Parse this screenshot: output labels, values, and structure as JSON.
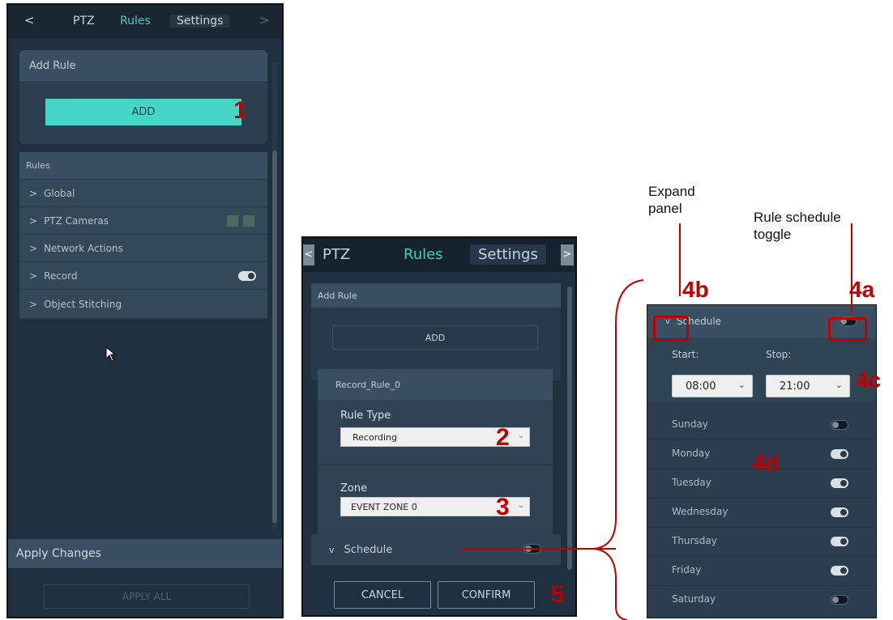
{
  "left_panel": {
    "tabs": {
      "prev": "<",
      "ptz": "PTZ",
      "rules": "Rules",
      "settings": "Settings",
      "next": ">"
    },
    "add_rule_header": "Add Rule",
    "add_button": "ADD",
    "rules_header": "Rules",
    "rule_groups": [
      {
        "label": "Global",
        "chevron": ">"
      },
      {
        "label": "PTZ Cameras",
        "chevron": ">"
      },
      {
        "label": "Network Actions",
        "chevron": ">"
      },
      {
        "label": "Record",
        "chevron": ">"
      },
      {
        "label": "Object Stitching",
        "chevron": ">"
      }
    ],
    "apply_changes_header": "Apply Changes",
    "apply_all_button": "APPLY ALL"
  },
  "middle_panel": {
    "tabs": {
      "prev": "<",
      "ptz": "PTZ",
      "rules": "Rules",
      "settings": "Settings",
      "next": ">"
    },
    "add_rule_header": "Add Rule",
    "add_button": "ADD",
    "rule_name": "Record_Rule_0",
    "rule_type_label": "Rule Type",
    "rule_type_value": "Recording",
    "zone_label": "Zone",
    "zone_value": "EVENT ZONE 0",
    "schedule_label": "Schedule",
    "schedule_chevron": "v",
    "cancel_button": "CANCEL",
    "confirm_button": "CONFIRM"
  },
  "right_panel": {
    "schedule_label": "Schedule",
    "schedule_chevron": "v",
    "start_label": "Start:",
    "start_value": "08:00",
    "stop_label": "Stop:",
    "stop_value": "21:00",
    "days": [
      {
        "name": "Sunday",
        "enabled": false
      },
      {
        "name": "Monday",
        "enabled": true
      },
      {
        "name": "Tuesday",
        "enabled": true
      },
      {
        "name": "Wednesday",
        "enabled": true
      },
      {
        "name": "Thursday",
        "enabled": true
      },
      {
        "name": "Friday",
        "enabled": true
      },
      {
        "name": "Saturday",
        "enabled": false
      }
    ]
  },
  "annotations": {
    "n1": "1",
    "n2": "2",
    "n3": "3",
    "n4a": "4a",
    "n4b": "4b",
    "n4c": "4c",
    "n4d": "4d",
    "n5": "5",
    "expand_panel": [
      "Expand",
      "panel"
    ],
    "rule_schedule_toggle": [
      "Rule schedule",
      "toggle"
    ]
  },
  "colors": {
    "accent": "#3ecfc0",
    "annotation": "#c00000",
    "panel_bg": "#1f3040"
  }
}
